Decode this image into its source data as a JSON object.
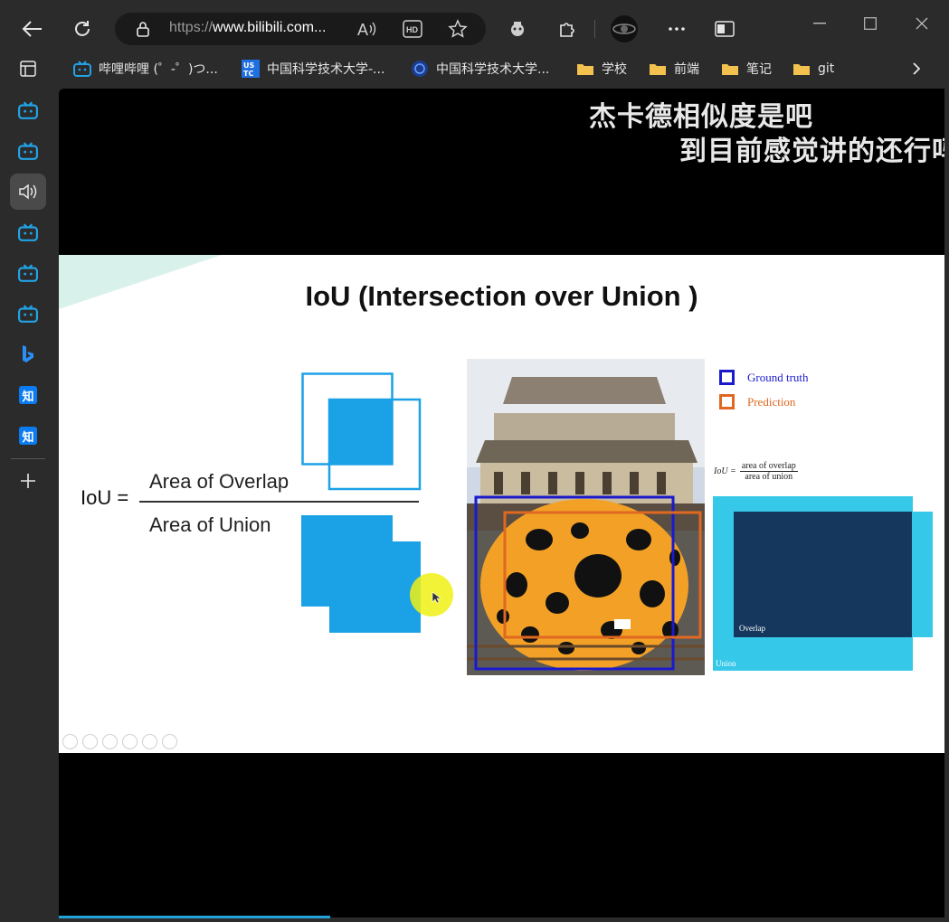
{
  "browser": {
    "url_prefix": "https://",
    "url_host": "www.bilibili.com...",
    "icons": [
      "back-icon",
      "refresh-icon",
      "lock-icon",
      "read-aloud-icon",
      "hd-icon",
      "favorite-star-icon",
      "extension-icon",
      "puzzle-icon",
      "profile-icon",
      "more-icon",
      "sidebar-toggle-icon"
    ]
  },
  "favorites": [
    {
      "label": "哔哩哔哩 (゜-゜)つ...",
      "icon": "bilibili-icon"
    },
    {
      "label": "中国科学技术大学-...",
      "icon": "ustc-icon"
    },
    {
      "label": "中国科学技术大学...",
      "icon": "ustc-globe-icon"
    },
    {
      "label": "学校",
      "icon": "folder-icon"
    },
    {
      "label": "前端",
      "icon": "folder-icon"
    },
    {
      "label": "笔记",
      "icon": "folder-icon"
    },
    {
      "label": "git",
      "icon": "folder-icon"
    }
  ],
  "sidebar": {
    "zhi_label": "知"
  },
  "video": {
    "subtitle_line1": "杰卡德相似度是吧",
    "subtitle_line2": "到目前感觉讲的还行吗"
  },
  "slide": {
    "title": "IoU (Intersection over Union )",
    "lhs": "IoU =",
    "numerator": "Area of Overlap",
    "denominator": "Area of Union",
    "legend_ground_truth": "Ground truth",
    "legend_prediction": "Prediction",
    "formula_lhs": "IoU =",
    "formula_num": "area of overlap",
    "formula_den": "area of union",
    "overlap_label": "Overlap",
    "union_label": "Union",
    "colors": {
      "accent_blue": "#1ba1e6",
      "ground_truth": "#1a1acc",
      "prediction": "#e06820",
      "union_cyan": "#36c8e8",
      "overlap_navy": "#15375e"
    }
  }
}
